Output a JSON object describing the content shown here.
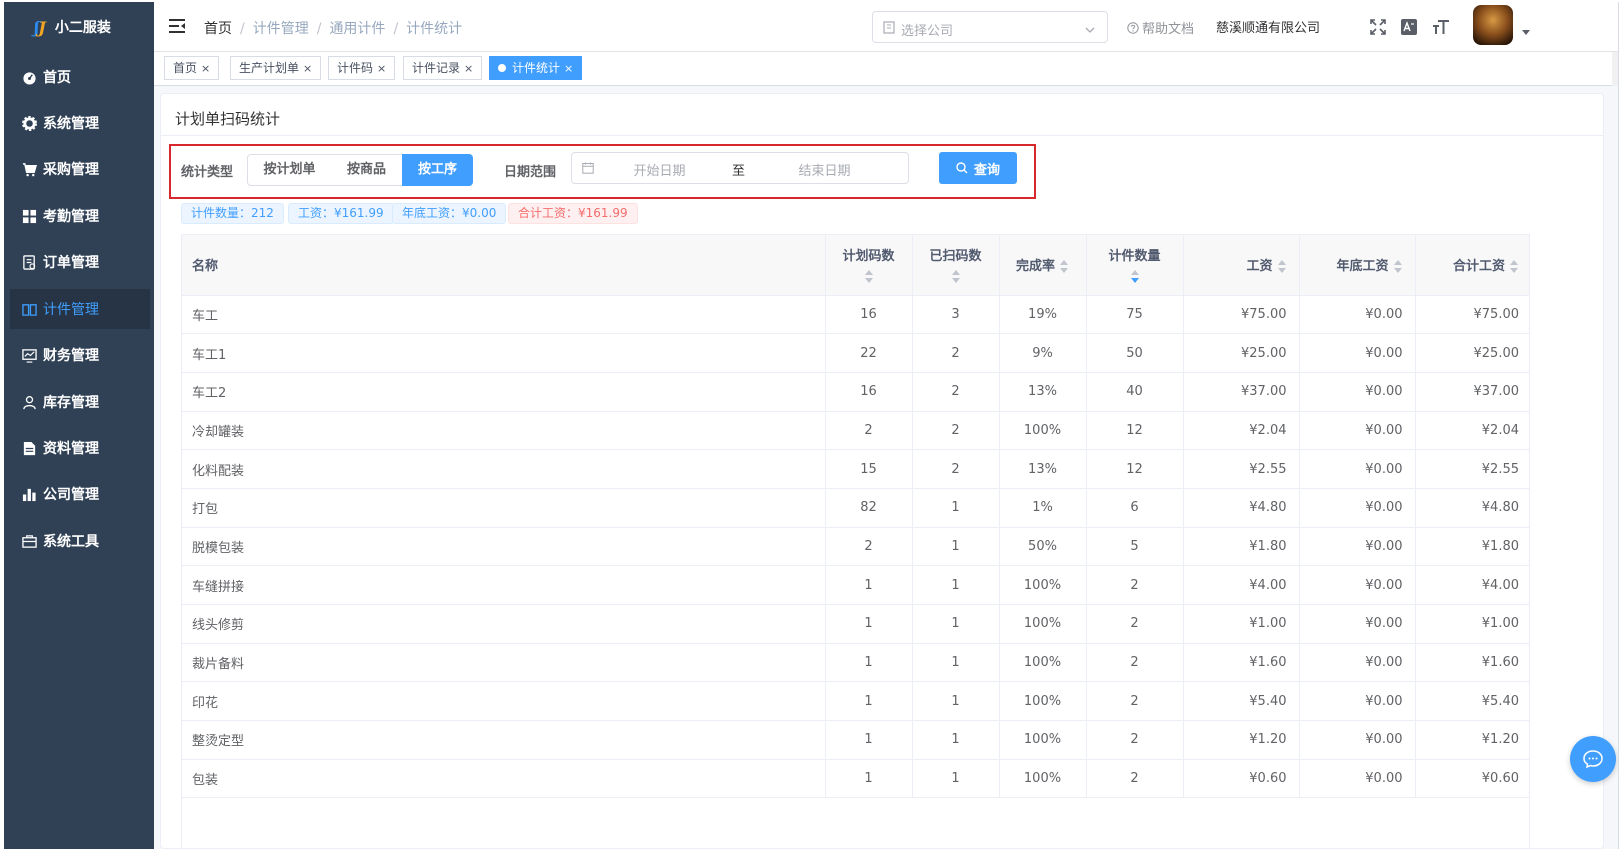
{
  "app": {
    "logo_mark_a": "ʃ",
    "logo_mark_b": "J",
    "title": "小二服装"
  },
  "sidebar": {
    "items": [
      {
        "label": "首页",
        "icon": "dashboard-icon"
      },
      {
        "label": "系统管理",
        "icon": "gear-icon"
      },
      {
        "label": "采购管理",
        "icon": "cart-icon"
      },
      {
        "label": "考勤管理",
        "icon": "grid-icon"
      },
      {
        "label": "订单管理",
        "icon": "order-icon"
      },
      {
        "label": "计件管理",
        "icon": "book-icon",
        "active": true
      },
      {
        "label": "财务管理",
        "icon": "monitor-icon"
      },
      {
        "label": "库存管理",
        "icon": "user-icon"
      },
      {
        "label": "资料管理",
        "icon": "document-icon"
      },
      {
        "label": "公司管理",
        "icon": "bar-chart-icon"
      },
      {
        "label": "系统工具",
        "icon": "toolbox-icon"
      }
    ]
  },
  "navbar": {
    "breadcrumb": [
      "首页",
      "计件管理",
      "通用计件",
      "计件统计"
    ],
    "separator": "/",
    "company_select_placeholder": "选择公司",
    "help_label": "帮助文档",
    "company_name": "慈溪顺通有限公司"
  },
  "tags": [
    {
      "label": "首页",
      "close": "×"
    },
    {
      "label": "生产计划单",
      "close": "×"
    },
    {
      "label": "计件码",
      "close": "×"
    },
    {
      "label": "计件记录",
      "close": "×"
    },
    {
      "label": "计件统计",
      "close": "×",
      "active": true
    }
  ],
  "page": {
    "title": "计划单扫码统计",
    "filter": {
      "type_label": "统计类型",
      "type_options": [
        "按计划单",
        "按商品",
        "按工序"
      ],
      "type_selected": "按工序",
      "date_label": "日期范围",
      "start_placeholder": "开始日期",
      "range_separator": "至",
      "end_placeholder": "结束日期",
      "query_label": "查询"
    },
    "summary": {
      "count": "计件数量：212",
      "wage": "工资：¥161.99",
      "year_end_wage": "年底工资：¥0.00",
      "total_wage": "合计工资：¥161.99"
    }
  },
  "table": {
    "headers": {
      "name": "名称",
      "plan_codes": "计划码数",
      "scanned_codes": "已扫码数",
      "completion": "完成率",
      "piece_count": "计件数量",
      "wage": "工资",
      "year_end_wage": "年底工资",
      "total_wage": "合计工资"
    },
    "rows": [
      [
        "车工",
        "16",
        "3",
        "19%",
        "75",
        "¥75.00",
        "¥0.00",
        "¥75.00"
      ],
      [
        "车工1",
        "22",
        "2",
        "9%",
        "50",
        "¥25.00",
        "¥0.00",
        "¥25.00"
      ],
      [
        "车工2",
        "16",
        "2",
        "13%",
        "40",
        "¥37.00",
        "¥0.00",
        "¥37.00"
      ],
      [
        "冷却罐装",
        "2",
        "2",
        "100%",
        "12",
        "¥2.04",
        "¥0.00",
        "¥2.04"
      ],
      [
        "化料配装",
        "15",
        "2",
        "13%",
        "12",
        "¥2.55",
        "¥0.00",
        "¥2.55"
      ],
      [
        "打包",
        "82",
        "1",
        "1%",
        "6",
        "¥4.80",
        "¥0.00",
        "¥4.80"
      ],
      [
        "脱模包装",
        "2",
        "1",
        "50%",
        "5",
        "¥1.80",
        "¥0.00",
        "¥1.80"
      ],
      [
        "车缝拼接",
        "1",
        "1",
        "100%",
        "2",
        "¥4.00",
        "¥0.00",
        "¥4.00"
      ],
      [
        "线头修剪",
        "1",
        "1",
        "100%",
        "2",
        "¥1.00",
        "¥0.00",
        "¥1.00"
      ],
      [
        "裁片备料",
        "1",
        "1",
        "100%",
        "2",
        "¥1.60",
        "¥0.00",
        "¥1.60"
      ],
      [
        "印花",
        "1",
        "1",
        "100%",
        "2",
        "¥5.40",
        "¥0.00",
        "¥5.40"
      ],
      [
        "整烫定型",
        "1",
        "1",
        "100%",
        "2",
        "¥1.20",
        "¥0.00",
        "¥1.20"
      ],
      [
        "包装",
        "1",
        "1",
        "100%",
        "2",
        "¥0.60",
        "¥0.00",
        "¥0.60"
      ]
    ]
  },
  "colors": {
    "sidebar_bg": "#304156",
    "primary": "#409eff",
    "danger": "#f56c6c",
    "highlight_border": "#d9272e"
  }
}
